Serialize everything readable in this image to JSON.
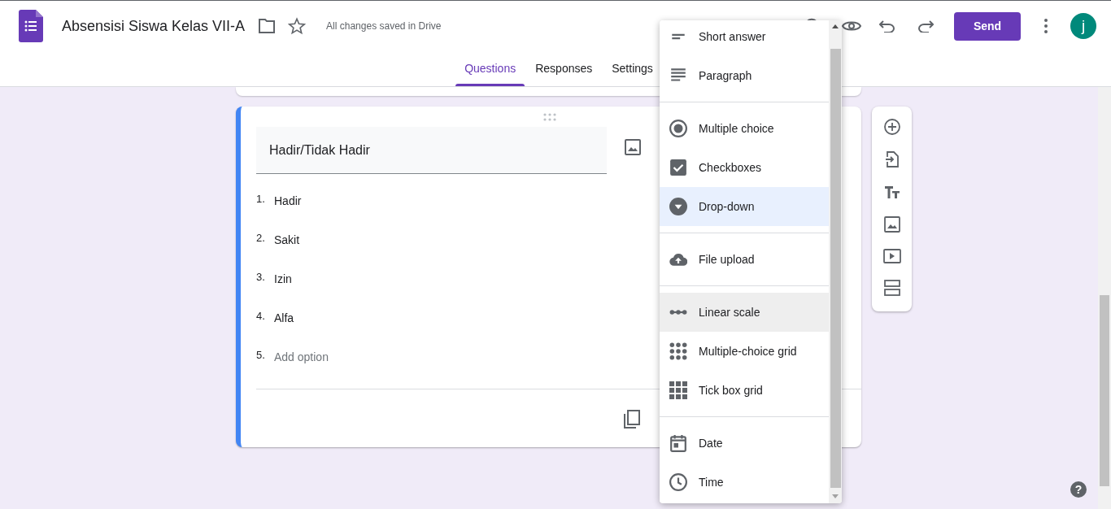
{
  "header": {
    "title": "Absensisi Siswa Kelas VII-A",
    "save_status": "All changes saved in Drive",
    "send_button": "Send",
    "avatar": "j"
  },
  "help_button": "?",
  "tabs": [
    {
      "label": "Questions",
      "selected": true
    },
    {
      "label": "Responses",
      "selected": false
    },
    {
      "label": "Settings",
      "selected": false
    }
  ],
  "question": {
    "title": "Hadir/Tidak Hadir",
    "options": [
      {
        "number": "1.",
        "label": "Hadir"
      },
      {
        "number": "2.",
        "label": "Sakit"
      },
      {
        "number": "3.",
        "label": "Izin"
      },
      {
        "number": "4.",
        "label": "Alfa"
      }
    ],
    "add_option": {
      "number": "5.",
      "label": "Add option"
    }
  },
  "type_menu": {
    "groups": [
      {
        "items": [
          {
            "kind": "short_answer",
            "label": "Short answer",
            "selected": false,
            "hovered": false
          },
          {
            "kind": "paragraph",
            "label": "Paragraph",
            "selected": false,
            "hovered": false
          }
        ]
      },
      {
        "items": [
          {
            "kind": "multiple_choice",
            "label": "Multiple choice",
            "selected": false,
            "hovered": false
          },
          {
            "kind": "checkboxes",
            "label": "Checkboxes",
            "selected": false,
            "hovered": false
          },
          {
            "kind": "dropdown",
            "label": "Drop-down",
            "selected": true,
            "hovered": false
          }
        ]
      },
      {
        "items": [
          {
            "kind": "file_upload",
            "label": "File upload",
            "selected": false,
            "hovered": false
          }
        ]
      },
      {
        "items": [
          {
            "kind": "linear_scale",
            "label": "Linear scale",
            "selected": false,
            "hovered": true
          },
          {
            "kind": "mc_grid",
            "label": "Multiple-choice grid",
            "selected": false,
            "hovered": false
          },
          {
            "kind": "tick_grid",
            "label": "Tick box grid",
            "selected": false,
            "hovered": false
          }
        ]
      },
      {
        "items": [
          {
            "kind": "date",
            "label": "Date",
            "selected": false,
            "hovered": false
          },
          {
            "kind": "time",
            "label": "Time",
            "selected": false,
            "hovered": false
          }
        ]
      }
    ]
  }
}
